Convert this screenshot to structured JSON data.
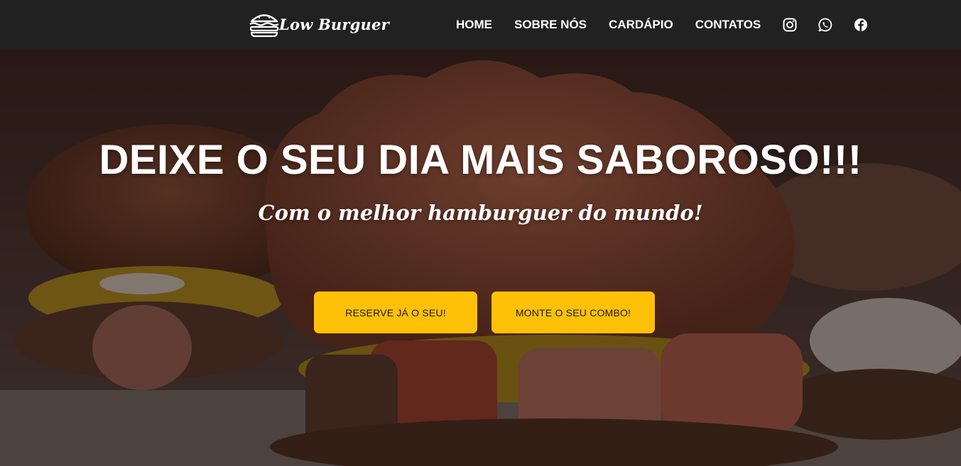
{
  "brand": {
    "name": "Low Burguer",
    "logo_icon": "burger-icon"
  },
  "nav": {
    "items": [
      {
        "label": "HOME"
      },
      {
        "label": "SOBRE NÓS"
      },
      {
        "label": "CARDÁPIO"
      },
      {
        "label": "CONTATOS"
      }
    ],
    "social": [
      {
        "icon": "instagram-icon"
      },
      {
        "icon": "whatsapp-icon"
      },
      {
        "icon": "facebook-icon"
      }
    ]
  },
  "hero": {
    "title": "DEIXE O SEU DIA MAIS SABOROSO!!!",
    "subtitle": "Com o melhor hamburguer do mundo!",
    "buttons": [
      {
        "label": "RESERVE JÁ O SEU!"
      },
      {
        "label": "MONTE O SEU COMBO!"
      }
    ]
  },
  "colors": {
    "navbar_bg": "#212121",
    "accent": "#ffc107",
    "text_light": "#ffffff"
  }
}
